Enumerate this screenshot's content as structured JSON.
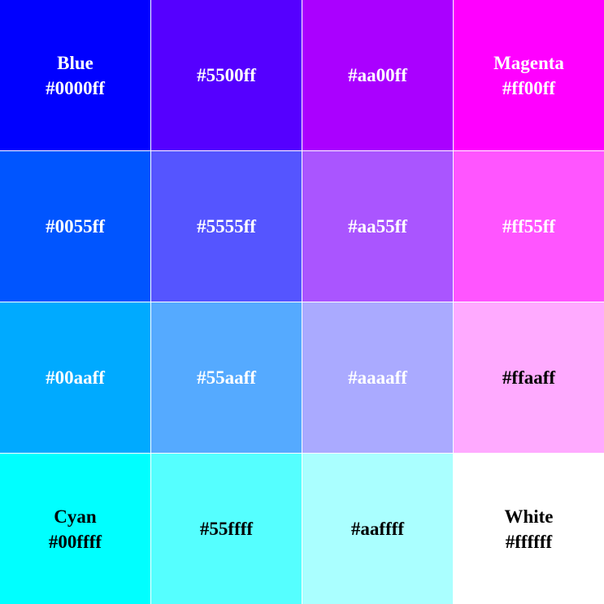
{
  "swatches": [
    {
      "name": "Blue",
      "hex": "#0000ff",
      "color": "#0000ff",
      "text_color": "#ffffff"
    },
    {
      "name": "",
      "hex": "#5500ff",
      "color": "#5500ff",
      "text_color": "#ffffff"
    },
    {
      "name": "",
      "hex": "#aa00ff",
      "color": "#aa00ff",
      "text_color": "#ffffff"
    },
    {
      "name": "Magenta",
      "hex": "#ff00ff",
      "color": "#ff00ff",
      "text_color": "#ffffff"
    },
    {
      "name": "",
      "hex": "#0055ff",
      "color": "#0055ff",
      "text_color": "#ffffff"
    },
    {
      "name": "",
      "hex": "#5555ff",
      "color": "#5555ff",
      "text_color": "#ffffff"
    },
    {
      "name": "",
      "hex": "#aa55ff",
      "color": "#aa55ff",
      "text_color": "#ffffff"
    },
    {
      "name": "",
      "hex": "#ff55ff",
      "color": "#ff55ff",
      "text_color": "#ffffff"
    },
    {
      "name": "",
      "hex": "#00aaff",
      "color": "#00aaff",
      "text_color": "#ffffff"
    },
    {
      "name": "",
      "hex": "#55aaff",
      "color": "#55aaff",
      "text_color": "#ffffff"
    },
    {
      "name": "",
      "hex": "#aaaaff",
      "color": "#aaaaff",
      "text_color": "#ffffff"
    },
    {
      "name": "",
      "hex": "#ffaaff",
      "color": "#ffaaff",
      "text_color": "#000000"
    },
    {
      "name": "Cyan",
      "hex": "#00ffff",
      "color": "#00ffff",
      "text_color": "#000000"
    },
    {
      "name": "",
      "hex": "#55ffff",
      "color": "#55ffff",
      "text_color": "#000000"
    },
    {
      "name": "",
      "hex": "#aaffff",
      "color": "#aaffff",
      "text_color": "#000000"
    },
    {
      "name": "White",
      "hex": "#ffffff",
      "color": "#ffffff",
      "text_color": "#000000"
    }
  ]
}
